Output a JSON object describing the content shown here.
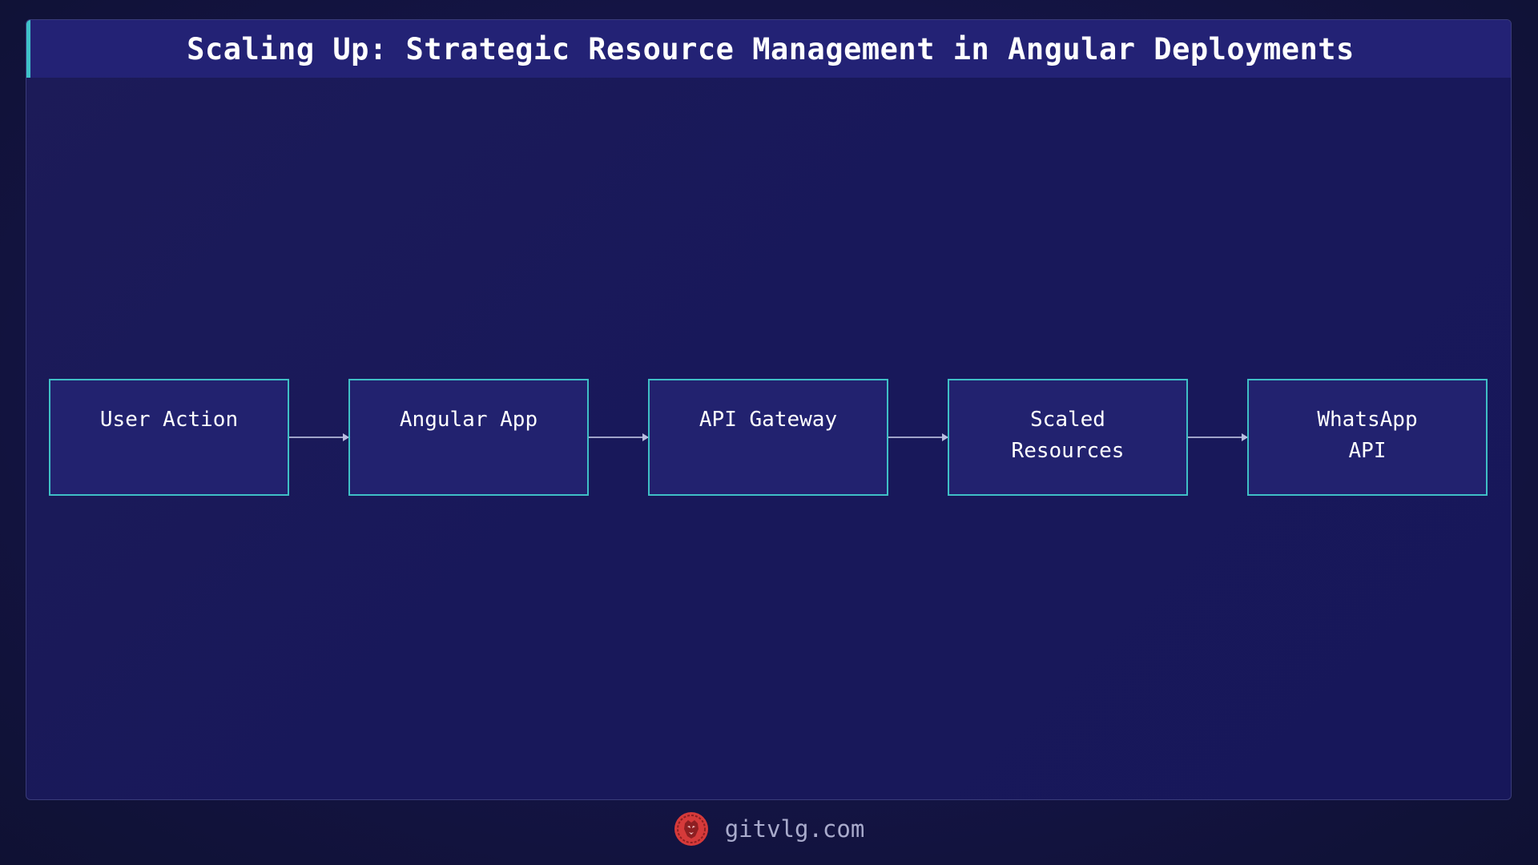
{
  "title": "Scaling Up: Strategic Resource Management in Angular Deployments",
  "nodes": [
    {
      "label": "User Action"
    },
    {
      "label": "Angular App"
    },
    {
      "label": "API Gateway"
    },
    {
      "label": "Scaled\nResources"
    },
    {
      "label": "WhatsApp\nAPI"
    }
  ],
  "footer": {
    "logo_icon": "lion-head-icon",
    "site": "gitvlg.com"
  },
  "colors": {
    "background": "#141445",
    "title_bar": "#232275",
    "accent": "#3fc2c9",
    "node_fill": "#22226f",
    "node_border": "#3fbfc6",
    "arrow": "#9fa3c9",
    "logo": "#d63a3a"
  }
}
